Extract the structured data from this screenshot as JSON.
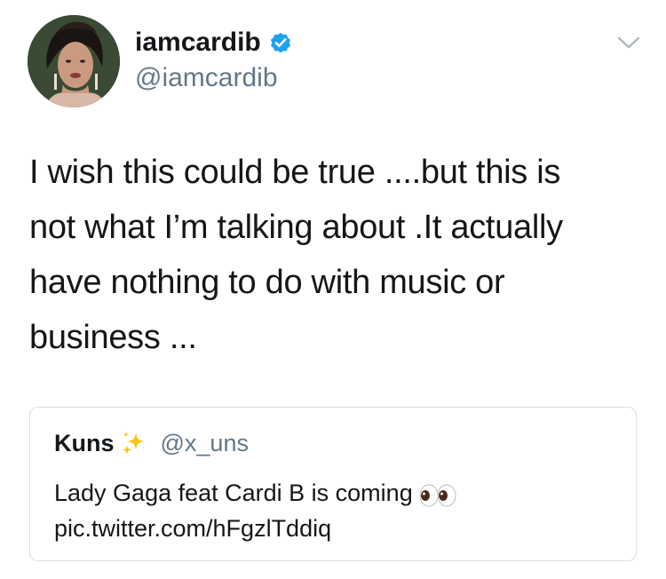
{
  "user": {
    "display_name": "iamcardib",
    "handle": "@iamcardib",
    "verified": true
  },
  "tweet": {
    "text": "I wish this could  be true ....but this is\nnot what I’m talking about .It actually\nhave nothing to do with music or\nbusiness ..."
  },
  "quoted_tweet": {
    "display_name": "Kuns",
    "handle": "@x_uns",
    "name_emoji": "sparkles-icon",
    "text_line1": "Lady Gaga feat Cardi B is coming",
    "text_emoji": "eyes-icon",
    "text_line2": "pic.twitter.com/hFgzlTddiq"
  },
  "colors": {
    "text": "#14171a",
    "secondary": "#657786",
    "verified_blue": "#1da1f2",
    "border": "#d9dfe4"
  }
}
